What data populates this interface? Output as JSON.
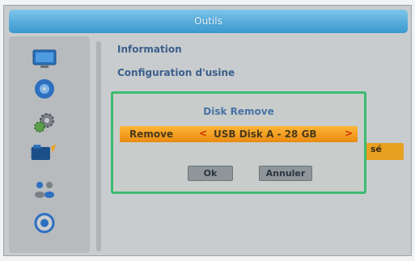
{
  "window": {
    "title": "Outils"
  },
  "menu": {
    "items": [
      {
        "label": "Information"
      },
      {
        "label": "Configuration d'usine"
      }
    ],
    "partial_right_text": "sé"
  },
  "sidebar": {
    "icons": [
      "monitor-icon",
      "disc-icon",
      "gear-icon",
      "folder-icon",
      "people-icon",
      "globe-icon"
    ]
  },
  "dialog": {
    "title": "Disk Remove",
    "row_label": "Remove",
    "left_arrow": "<",
    "value": "USB Disk A - 28 GB",
    "right_arrow": ">",
    "ok_label": "Ok",
    "cancel_label": "Annuler"
  },
  "colors": {
    "accent": "#3a98cf",
    "dialog_border": "#3dbb72",
    "selection": "#f0a020"
  }
}
